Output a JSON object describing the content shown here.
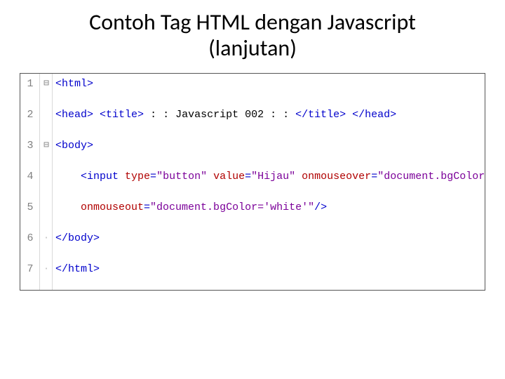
{
  "title_line1": "Contoh Tag HTML dengan Javascript",
  "title_line2": "(lanjutan)",
  "code": {
    "line1": {
      "num": "1",
      "fold": "⊟",
      "tag_open": "<html>"
    },
    "line2": {
      "num": "2",
      "head_open": "<head>",
      "sp1": " ",
      "title_open": "<title>",
      "sp2": " ",
      "title_text": ": : Javascript 002 : :",
      "sp3": " ",
      "title_close": "</title>",
      "sp4": " ",
      "head_close": "</head>"
    },
    "line3": {
      "num": "3",
      "fold": "⊟",
      "body_open": "<body>"
    },
    "line4": {
      "num": "4",
      "indent": "    ",
      "input_open": "<input ",
      "attr_type_name": "type",
      "eq1": "=",
      "attr_type_val": "\"button\"",
      "sp1": " ",
      "attr_value_name": "value",
      "eq2": "=",
      "attr_value_val": "\"Hijau\"",
      "sp2": " ",
      "attr_over_name": "onmouseover",
      "eq3": "=",
      "attr_over_val": "\"document.bgColor='green'\""
    },
    "line5": {
      "num": "5",
      "indent": "    ",
      "attr_out_name": "onmouseout",
      "eq4": "=",
      "attr_out_val": "\"document.bgColor='white'\"",
      "input_close": "/>"
    },
    "line6": {
      "num": "6",
      "mark": "·",
      "body_close": "</body>"
    },
    "line7": {
      "num": "7",
      "mark": "·",
      "html_close": "</html>"
    }
  }
}
